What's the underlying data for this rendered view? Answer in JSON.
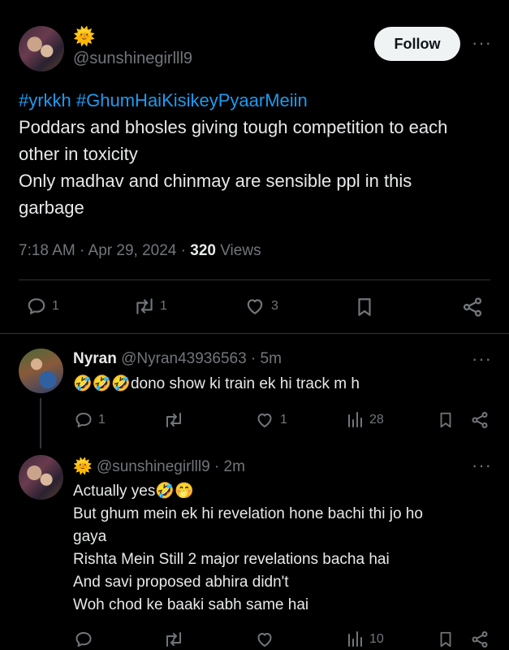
{
  "main_post": {
    "emoji": "🌞",
    "handle": "@sunshinegirlll9",
    "follow_label": "Follow",
    "more_label": "···",
    "hashtags": "#yrkkh #GhumHaiKisikeyPyaarMeiin",
    "lines": [
      "Poddars and bhosles giving tough competition to each",
      "other in toxicity",
      "Only madhav and chinmay are sensible ppl in this",
      "garbage"
    ],
    "time": "7:18 AM · Apr 29, 2024 · ",
    "views_count": "320",
    "views_label": " Views",
    "replies": "1",
    "reposts": "1",
    "likes": "3"
  },
  "reply1": {
    "name": "Nyran",
    "handle": "@Nyran43936563 · 5m",
    "emojis": "🤣🤣🤣",
    "text": "dono show ki train ek hi track m h",
    "replies": "1",
    "likes": "1",
    "views": "28",
    "more_label": "···"
  },
  "reply2": {
    "emoji": "🌞",
    "handle": "@sunshinegirlll9 · 2m",
    "first_line": "Actually yes",
    "first_emojis": "🤣🤭",
    "lines": [
      "But ghum mein ek hi revelation hone bachi thi jo ho",
      "gaya",
      "Rishta Mein Still 2 major revelations bacha hai",
      "And savi proposed abhira didn't",
      "Woh chod ke baaki sabh same hai"
    ],
    "views": "10",
    "more_label": "···"
  }
}
